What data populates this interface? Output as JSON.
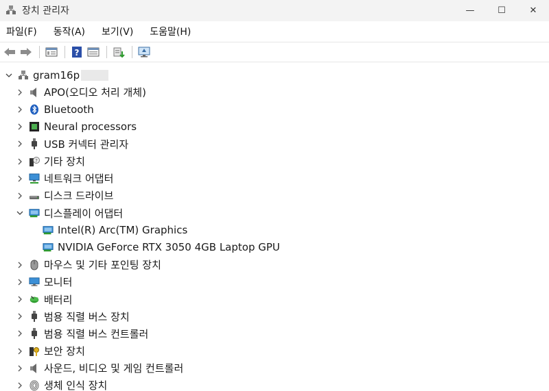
{
  "window": {
    "title": "장치 관리자",
    "minimize": "—",
    "maximize": "☐",
    "close": "✕"
  },
  "menu": [
    "파일(F)",
    "동작(A)",
    "보기(V)",
    "도움말(H)"
  ],
  "toolbar": [
    "back-icon",
    "forward-icon",
    "properties-icon",
    "help-icon",
    "details-icon",
    "update-driver-icon",
    "monitor-scan-icon"
  ],
  "tree": {
    "root": "gram16p",
    "categories": [
      {
        "label": "APO(오디오 처리 개체)",
        "icon": "speaker-icon"
      },
      {
        "label": "Bluetooth",
        "icon": "bluetooth-icon"
      },
      {
        "label": "Neural processors",
        "icon": "chip-icon"
      },
      {
        "label": "USB 커넥터 관리자",
        "icon": "usb-plug-icon"
      },
      {
        "label": "기타 장치",
        "icon": "unknown-device-icon"
      },
      {
        "label": "네트워크 어댑터",
        "icon": "network-icon"
      },
      {
        "label": "디스크 드라이브",
        "icon": "disk-drive-icon"
      },
      {
        "label": "디스플레이 어댑터",
        "icon": "display-adapter-icon",
        "expanded": true,
        "children": [
          {
            "label": "Intel(R) Arc(TM) Graphics",
            "icon": "display-adapter-icon"
          },
          {
            "label": "NVIDIA GeForce RTX 3050 4GB Laptop GPU",
            "icon": "display-adapter-icon"
          }
        ]
      },
      {
        "label": "마우스 및 기타 포인팅 장치",
        "icon": "mouse-icon"
      },
      {
        "label": "모니터",
        "icon": "monitor-icon"
      },
      {
        "label": "배터리",
        "icon": "battery-icon"
      },
      {
        "label": "범용 직렬 버스 장치",
        "icon": "usb-plug-icon"
      },
      {
        "label": "범용 직렬 버스 컨트롤러",
        "icon": "usb-plug-icon"
      },
      {
        "label": "보안 장치",
        "icon": "security-device-icon"
      },
      {
        "label": "사운드, 비디오 및 게임 컨트롤러",
        "icon": "speaker-icon"
      },
      {
        "label": "생체 인식 장치",
        "icon": "fingerprint-icon"
      }
    ]
  },
  "colors": {
    "titlebar": "#f3f3f3",
    "accent": "#1e6fd9",
    "text": "#1a1a1a"
  }
}
